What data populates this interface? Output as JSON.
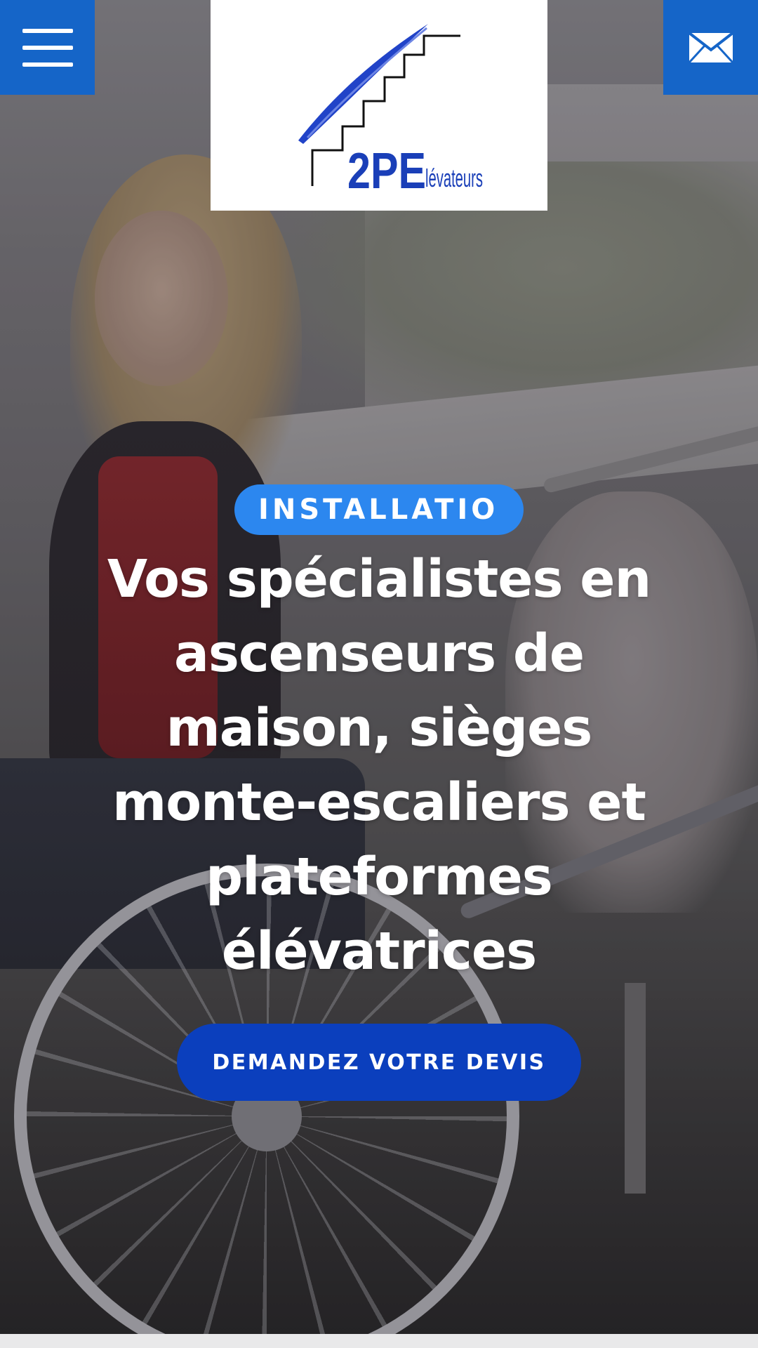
{
  "header": {
    "menu_icon": "hamburger-menu-icon",
    "mail_icon": "envelope-icon",
    "logo": {
      "text_main": "2PE",
      "text_sub": "lévateurs",
      "icon": "staircase-logo-icon",
      "colors": {
        "blue": "#1a3fb8",
        "black": "#111111"
      }
    },
    "accent_color": "#1565c8"
  },
  "hero": {
    "badge": "INSTALLATIO",
    "headline": "Vos spécialistes en ascenseurs de maison, sièges monte-escaliers et plateformes élévatrices",
    "cta_label": "DEMANDEZ VOTRE DEVIS",
    "colors": {
      "badge": "#2c87ef",
      "cta": "#0b3fbd",
      "headline": "#ffffff"
    }
  }
}
